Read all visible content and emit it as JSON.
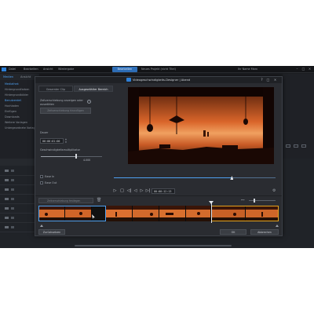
{
  "app": {
    "menu": [
      "Datei",
      "Bearbeiten",
      "Ansicht",
      "Wiedergabe"
    ],
    "active_tab": "Bearbeiten",
    "project_title": "Neues Projekt (nicht Titel)",
    "user": "Ihr Name Marx",
    "left_tabs": [
      "Medien",
      "Ansicht"
    ],
    "library_items": [
      "Mediathek",
      "Hintergrundfarben",
      "Hintergrundbilder",
      "Benutzerdef.",
      "Hochladen",
      "Einfügen",
      "Downloads",
      "Weitere Vorlagen",
      "Untergeordnete Vorlagen"
    ],
    "right_panel_text": "Szene"
  },
  "dialog": {
    "title": "Videogeschwindigkeits-Designer | Abend",
    "buttons": {
      "help": "?",
      "minimize": "–",
      "maximize": "□",
      "close": "×"
    },
    "tabs": {
      "inactive": "Gesamter Clip",
      "active": "Ausgewählter Bereich"
    },
    "option_label": "Zeitverschiebung anzeigen oder auswählen",
    "info_icon": "i",
    "add_button": "Zeitverschiebung hinzufügen",
    "duration_label": "Dauer",
    "duration_value": "00:00:01:00",
    "speed_label": "Geschwindigkeitsmultiplikator",
    "speed_value": "4.000",
    "speed_fraction": 0.58,
    "ease_in": "Ease In",
    "ease_out": "Ease Out",
    "preview_time": "00:00:12:13",
    "preview_progress": 0.73,
    "playback_icons": [
      "▷",
      "□",
      "◁|",
      "◁",
      "▷",
      "▷|"
    ],
    "gear_icon": "⚙",
    "select_range_button": "Zeitverschiebung festlegen",
    "trash_icon": "🗑",
    "zoom_icon": "⊷",
    "footer": {
      "reset": "Zurücksetzen",
      "ok": "OK",
      "cancel": "Abbrechen"
    }
  },
  "colors": {
    "accent_blue": "#4ea0f0",
    "selection_orange": "#e6a21d",
    "app_accent": "#2f6fb8"
  }
}
